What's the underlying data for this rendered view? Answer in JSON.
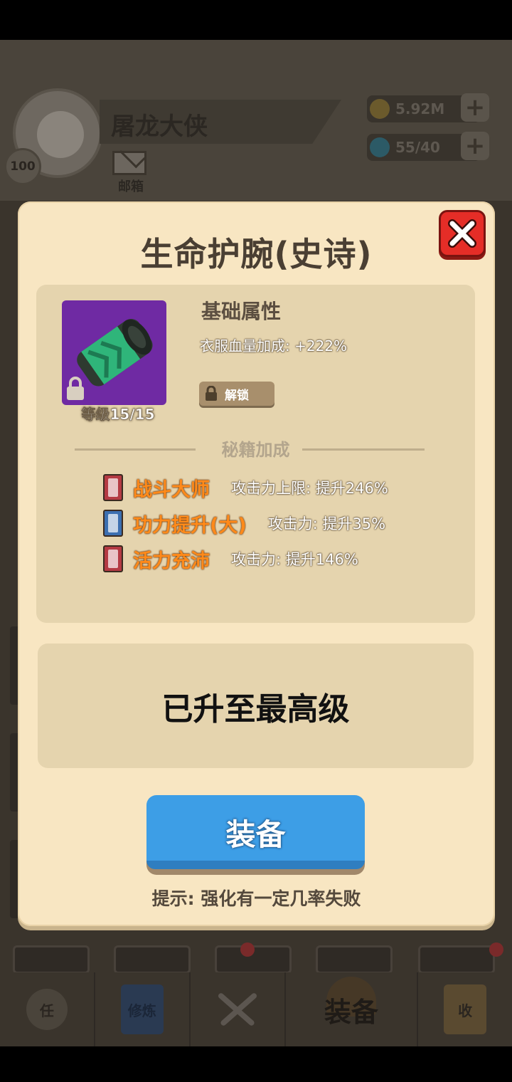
{
  "player": {
    "name": "屠龙大侠",
    "level": "100",
    "mail_label": "邮箱"
  },
  "resources": [
    {
      "icon": "coin-icon",
      "value": "5.92M",
      "color": "#d9a62a"
    },
    {
      "icon": "gem-icon",
      "value": "55/40",
      "color": "#2ab7d9"
    }
  ],
  "modal": {
    "title": "生命护腕(史诗)",
    "item": {
      "icon": "bracer-icon",
      "level_text": "等级15/15",
      "rarity_color": "#6f2aa3"
    },
    "base_attr": {
      "title": "基础属性",
      "line": "衣服血量加成: +222%"
    },
    "unlock_label": "解锁",
    "cheats_label": "秘籍加成",
    "cheats": [
      {
        "book": "red",
        "name": "战斗大师",
        "desc": "攻击力上限: 提升246%"
      },
      {
        "book": "blue",
        "name": "功力提升(大)",
        "desc": "攻击力: 提升35%"
      },
      {
        "book": "red",
        "name": "活力充沛",
        "desc": "攻击力: 提升146%"
      }
    ],
    "status": "已升至最高级",
    "equip_label": "装备",
    "hint": "提示: 强化有一定几率失败"
  },
  "navbar": {
    "items": [
      {
        "icon": "task-scroll-icon",
        "label": "任"
      },
      {
        "icon": "training-book-icon",
        "label": "修炼"
      },
      {
        "icon": "crossed-swords-icon",
        "label": ""
      },
      {
        "icon": "helmet-icon",
        "label": "装备",
        "active": true
      },
      {
        "icon": "shop-icon",
        "label": "收"
      }
    ]
  },
  "colors": {
    "modal_bg": "#f8e6c2",
    "panel_bg": "#e5d4ae",
    "accent_blue": "#3d9ee6",
    "close_red": "#e52d27",
    "cheat_orange": "#ff8a1a"
  }
}
